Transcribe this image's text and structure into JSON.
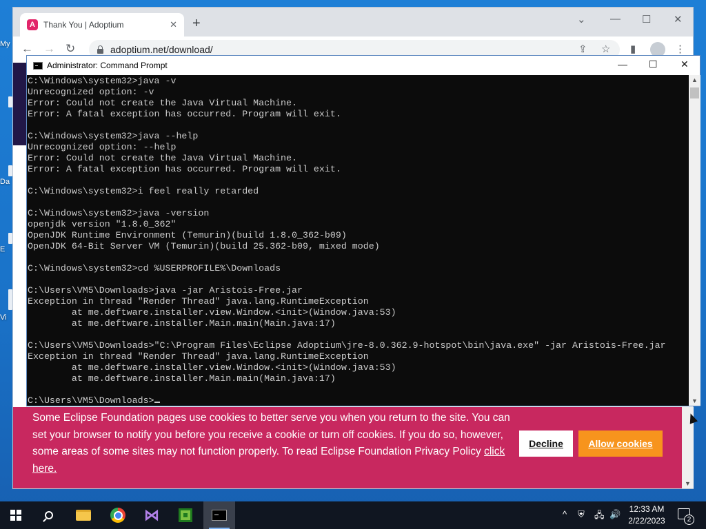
{
  "desktop": {
    "labels": [
      "My",
      "Da",
      "E",
      "Vi"
    ]
  },
  "browser": {
    "tab_title": "Thank You | Adoptium",
    "tab_close": "✕",
    "new_tab": "+",
    "favicon_letter": "A",
    "url": "adoptium.net/download/",
    "controls": {
      "tab_search": "⌄",
      "minimize": "—",
      "maximize": "☐",
      "close": "✕"
    },
    "nav": {
      "back": "←",
      "forward": "→",
      "reload": "↻"
    },
    "toolbar_icons": {
      "share": "⇪",
      "bookmark": "☆",
      "sidebar": "▮",
      "menu": "⋮"
    }
  },
  "cmd": {
    "title": "Administrator: Command Prompt",
    "controls": {
      "minimize": "—",
      "maximize": "☐",
      "close": "✕"
    },
    "lines": [
      "C:\\Windows\\system32>java -v",
      "Unrecognized option: -v",
      "Error: Could not create the Java Virtual Machine.",
      "Error: A fatal exception has occurred. Program will exit.",
      "",
      "C:\\Windows\\system32>java --help",
      "Unrecognized option: --help",
      "Error: Could not create the Java Virtual Machine.",
      "Error: A fatal exception has occurred. Program will exit.",
      "",
      "C:\\Windows\\system32>i feel really retarded",
      "",
      "C:\\Windows\\system32>java -version",
      "openjdk version \"1.8.0_362\"",
      "OpenJDK Runtime Environment (Temurin)(build 1.8.0_362-b09)",
      "OpenJDK 64-Bit Server VM (Temurin)(build 25.362-b09, mixed mode)",
      "",
      "C:\\Windows\\system32>cd %USERPROFILE%\\Downloads",
      "",
      "C:\\Users\\VM5\\Downloads>java -jar Aristois-Free.jar",
      "Exception in thread \"Render Thread\" java.lang.RuntimeException",
      "        at me.deftware.installer.view.Window.<init>(Window.java:53)",
      "        at me.deftware.installer.Main.main(Main.java:17)",
      "",
      "C:\\Users\\VM5\\Downloads>\"C:\\Program Files\\Eclipse Adoptium\\jre-8.0.362.9-hotspot\\bin\\java.exe\" -jar Aristois-Free.jar",
      "Exception in thread \"Render Thread\" java.lang.RuntimeException",
      "        at me.deftware.installer.view.Window.<init>(Window.java:53)",
      "        at me.deftware.installer.Main.main(Main.java:17)",
      ""
    ],
    "prompt": "C:\\Users\\VM5\\Downloads>"
  },
  "cookie_banner": {
    "text": "Some Eclipse Foundation pages use cookies to better serve you when you return to the site. You can set your browser to notify you before you receive a cookie or turn off cookies. If you do so, however, some areas of some sites may not function properly. To read Eclipse Foundation Privacy Policy",
    "link": "click here.",
    "decline": "Decline",
    "allow": "Allow cookies",
    "background": "#c8285f",
    "allow_color": "#f7941d"
  },
  "taskbar": {
    "icons": [
      "windows-start-icon",
      "search-icon",
      "file-explorer-icon",
      "chrome-icon",
      "visual-studio-icon",
      "minecraft-launcher-icon",
      "command-prompt-icon"
    ],
    "tray": {
      "chevron": "^",
      "network": "🖧",
      "volume": "🔊"
    },
    "time": "12:33 AM",
    "date": "2/22/2023",
    "notification_count": "2"
  }
}
